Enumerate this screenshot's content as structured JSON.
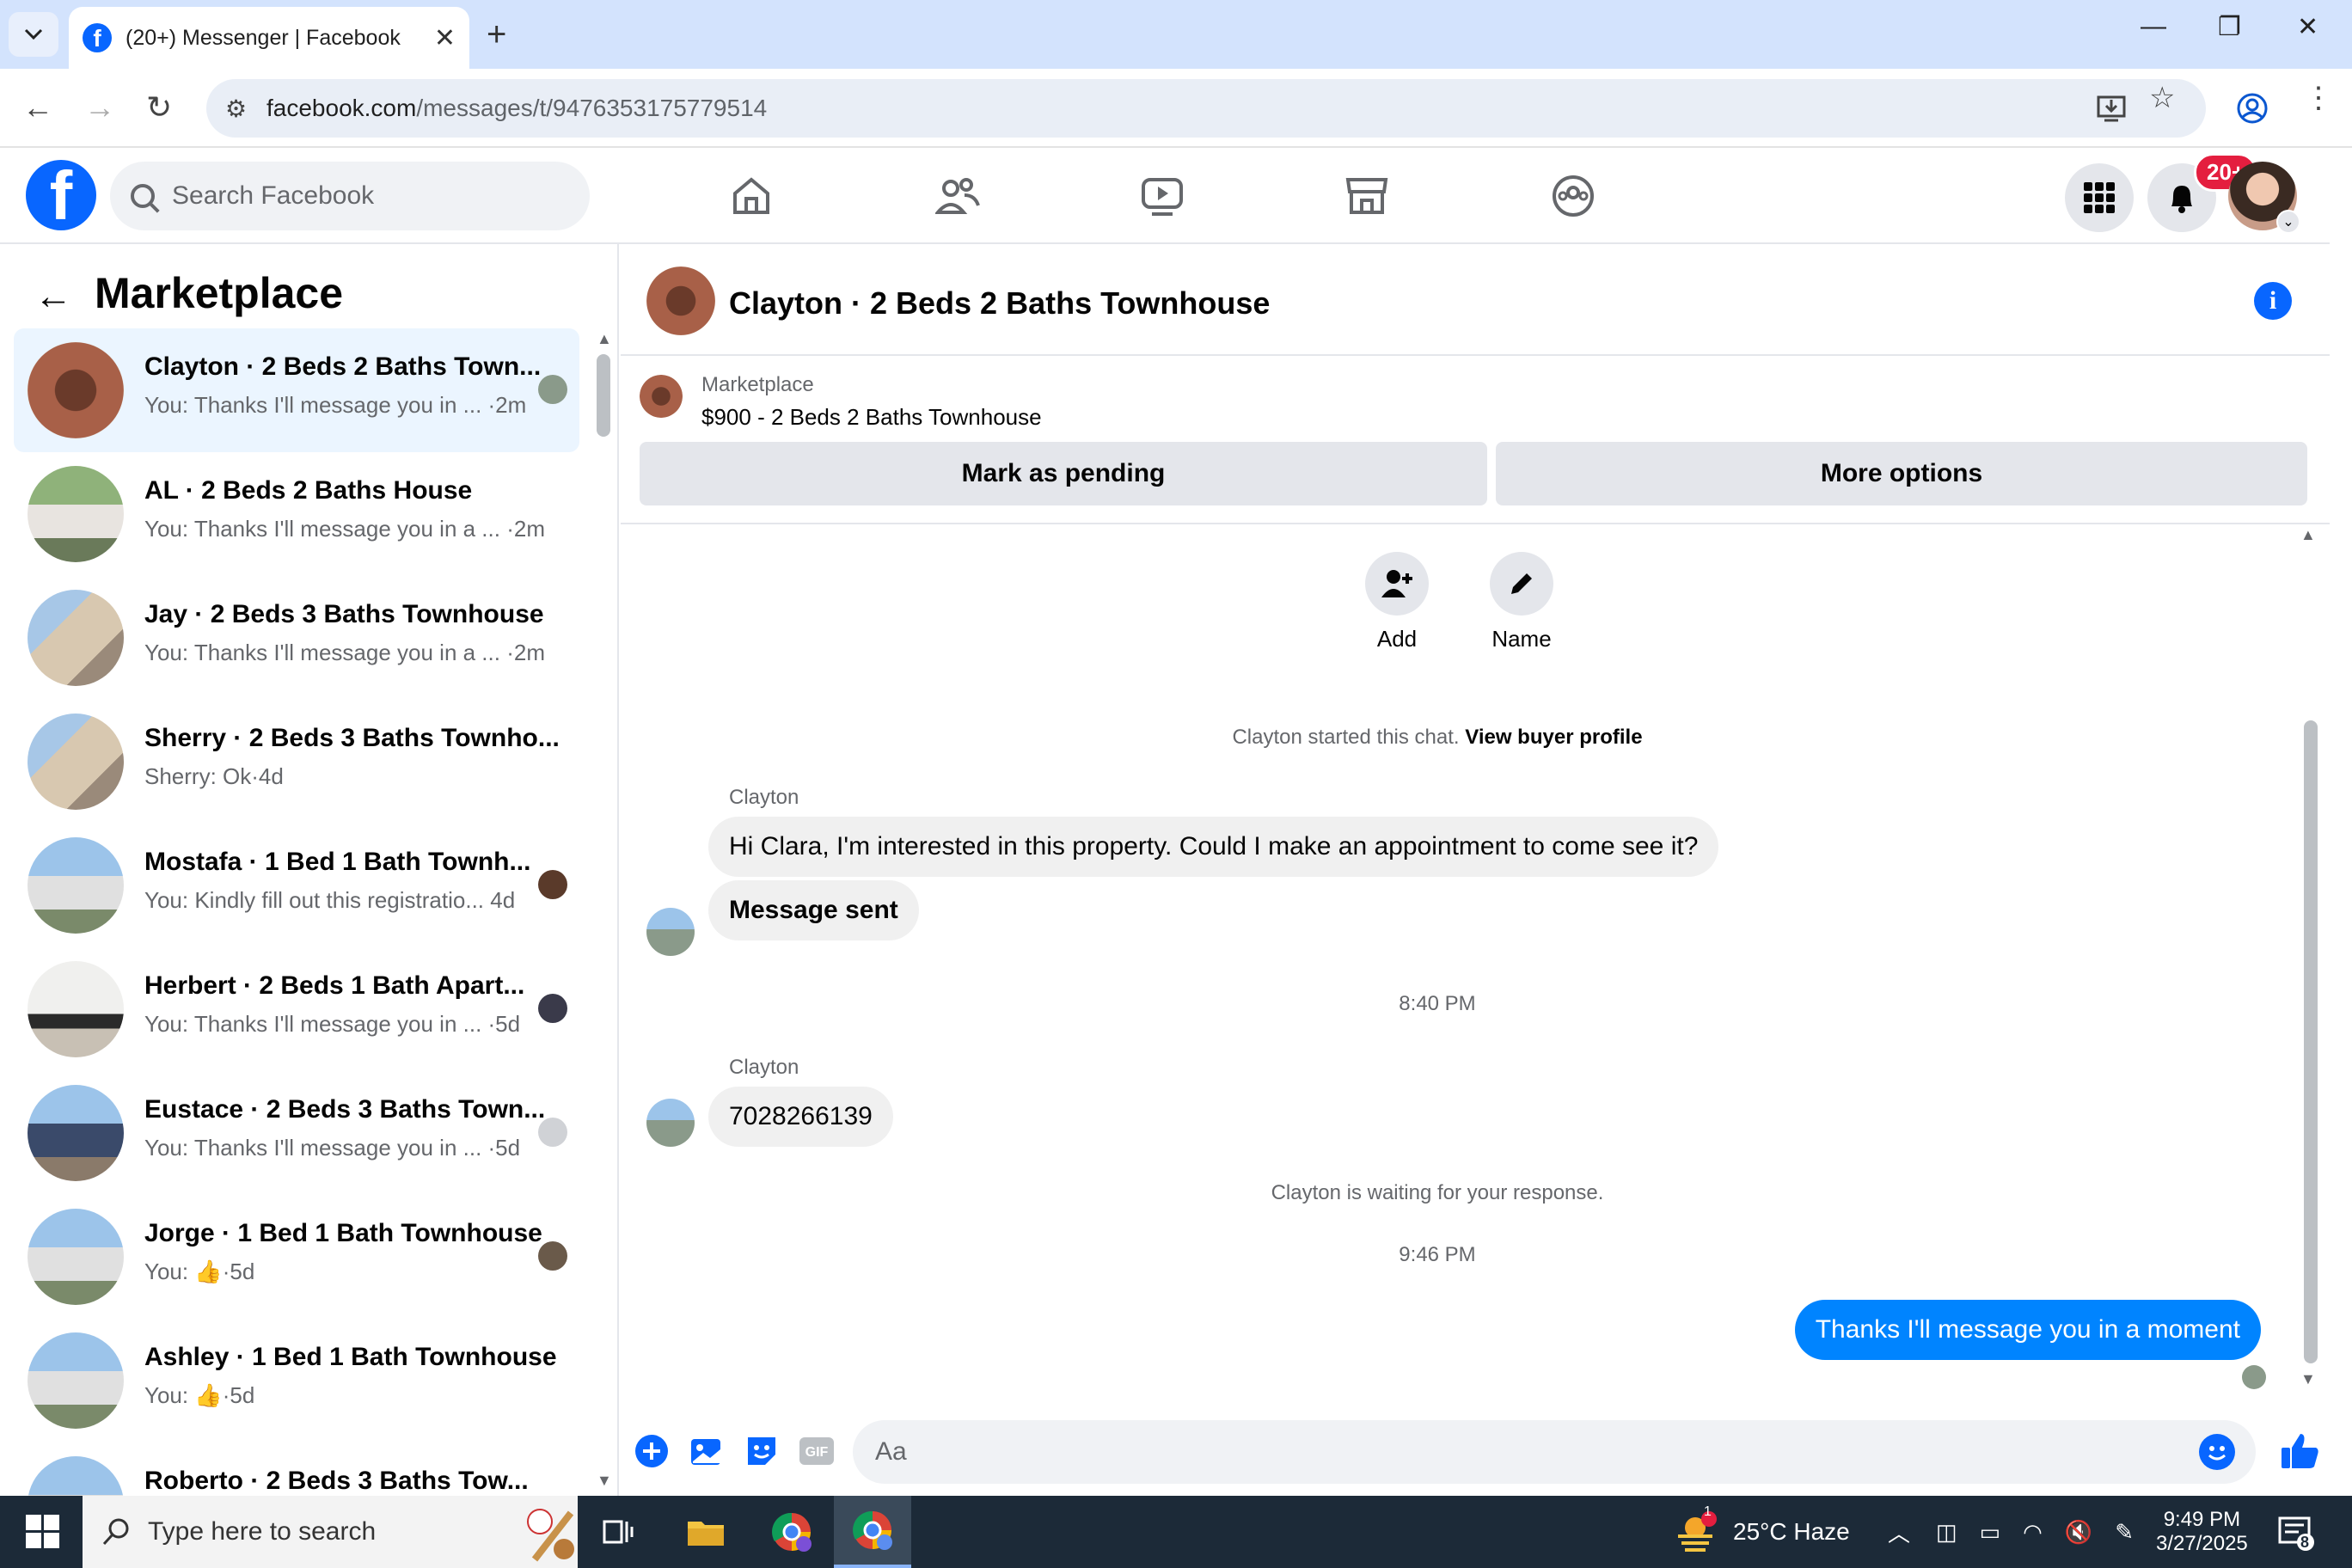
{
  "browser": {
    "tab_title": "(20+) Messenger | Facebook",
    "tab_close": "✕",
    "new_tab": "+",
    "url_host": "facebook.com",
    "url_path": "/messages/t/9476353175779514",
    "window_controls": [
      "—",
      "❐",
      "✕"
    ]
  },
  "facebook": {
    "search_placeholder": "Search Facebook",
    "notification_badge": "20+"
  },
  "sidebar": {
    "title": "Marketplace",
    "conversations": [
      {
        "name": "Clayton · 2 Beds 2 Baths Town...",
        "preview": "You: Thanks I'll message you in ... ·2m",
        "active": true
      },
      {
        "name": "AL · 2 Beds 2 Baths House",
        "preview": "You: Thanks I'll message you in a ... ·2m"
      },
      {
        "name": "Jay · 2 Beds 3 Baths Townhouse",
        "preview": "You: Thanks I'll message you in a ... ·2m"
      },
      {
        "name": "Sherry · 2 Beds 3 Baths Townho...",
        "preview": "Sherry: Ok·4d"
      },
      {
        "name": "Mostafa · 1 Bed 1 Bath Townh...",
        "preview": "You: Kindly fill out this registratio... 4d"
      },
      {
        "name": "Herbert · 2 Beds 1 Bath Apart...",
        "preview": "You: Thanks I'll message you in ... ·5d"
      },
      {
        "name": "Eustace · 2 Beds 3 Baths Town...",
        "preview": "You: Thanks I'll message you in ... ·5d"
      },
      {
        "name": "Jorge · 1 Bed 1 Bath Townhouse",
        "preview_prefix": "You:",
        "preview_suffix": "·5d"
      },
      {
        "name": "Ashley · 1 Bed 1 Bath Townhouse",
        "preview_prefix": "You:",
        "preview_suffix": "·5d"
      },
      {
        "name": "Roberto · 2 Beds 3 Baths Tow...",
        "preview": ""
      }
    ]
  },
  "chat": {
    "title": "Clayton · 2 Beds 2 Baths Townhouse",
    "listing_label": "Marketplace",
    "listing_price": "$900 - 2 Beds 2 Baths Townhouse",
    "btn_pending": "Mark as pending",
    "btn_more": "More options",
    "action_add": "Add",
    "action_name": "Name",
    "started_text": "Clayton started this chat.",
    "buyer_profile_link": "View buyer profile",
    "sender_1": "Clayton",
    "msg_1": "Hi Clara, I'm interested in this property. Could I make an appointment to come see it?",
    "msg_2": "Message sent",
    "time_1": "8:40 PM",
    "sender_2": "Clayton",
    "msg_3": "7028266139",
    "waiting_text": "Clayton is waiting for your response.",
    "time_2": "9:46 PM",
    "my_msg": "Thanks I'll message you in a moment",
    "composer_placeholder": "Aa"
  },
  "taskbar": {
    "search_placeholder": "Type here to search",
    "weather": "25°C  Haze",
    "time": "9:49 PM",
    "date": "3/27/2025",
    "weather_badge": "1",
    "notif_count": "8"
  },
  "colors": {
    "fb_blue": "#0866ff",
    "my_bubble": "#0084ff",
    "active_row": "#ebf5ff",
    "badge_red": "#e41e3f"
  }
}
